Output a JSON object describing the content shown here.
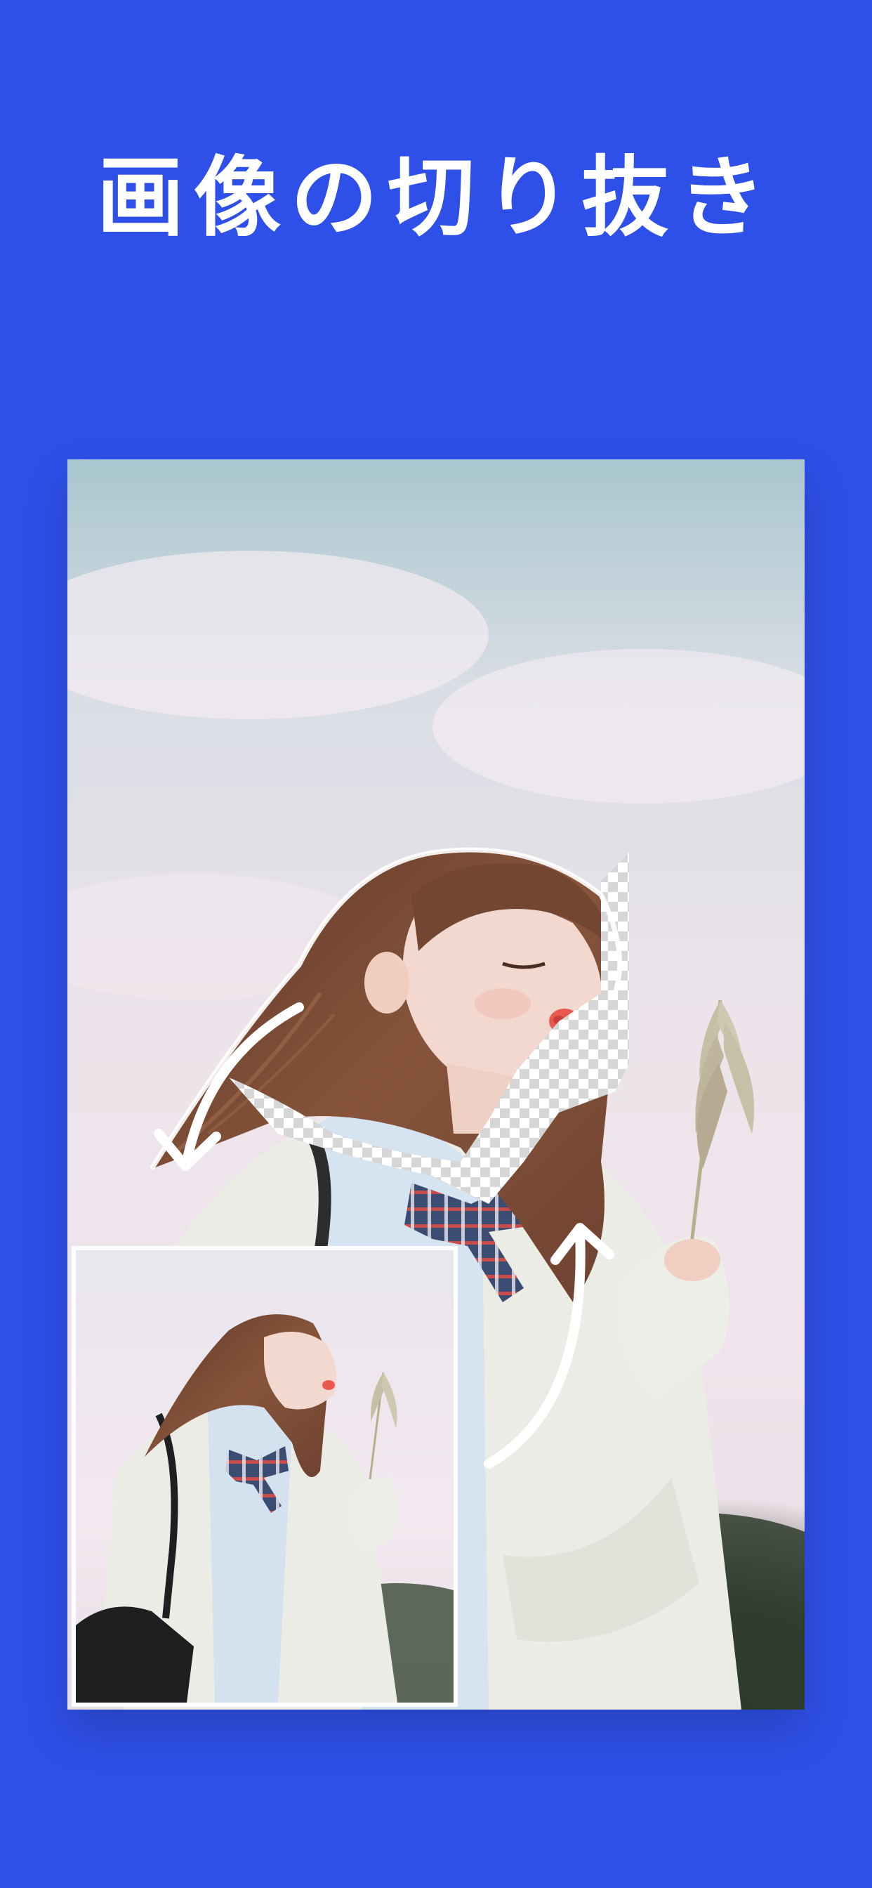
{
  "page": {
    "title": "画像の切り抜き"
  },
  "colors": {
    "background": "#2f50e8",
    "title_text": "#ffffff",
    "sky_top": "#a9c6cf",
    "sky_mid": "#e9e3ea",
    "sky_pink": "#f1e4ec",
    "foliage_dark": "#2e3b2c",
    "hair": "#7b4a33",
    "skin": "#f3d8cf",
    "cardigan": "#ecece6",
    "shirt": "#d6e3f1",
    "ribbon": "#33466a",
    "checker_light": "#ffffff",
    "checker_dark": "#d6d6d6",
    "arrow": "#ffffff"
  },
  "images": {
    "main_photo": "girl-with-grass-photo",
    "inset_photo": "original-photo-thumbnail"
  },
  "icons": {
    "arrow_down": "curved-arrow-down-icon",
    "arrow_up": "curved-arrow-up-icon"
  }
}
